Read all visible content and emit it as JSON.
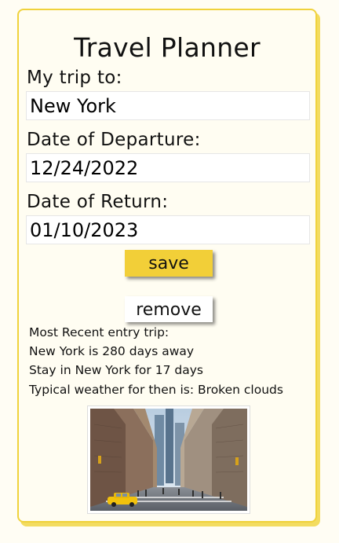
{
  "app": {
    "title": "Travel Planner"
  },
  "form": {
    "destination_label": "My trip to:",
    "destination_value": "New York",
    "departure_label": "Date of Departure:",
    "departure_value": "12/24/2022",
    "return_label": "Date of Return:",
    "return_value": "01/10/2023",
    "save_label": "save",
    "remove_label": "remove"
  },
  "entry": {
    "heading": "Most Recent entry trip:",
    "days_away": "New York is 280 days away",
    "stay_length": "Stay in New York for 17 days",
    "weather": "Typical weather for then is: Broken clouds"
  },
  "colors": {
    "accent": "#f2cf38",
    "card_border": "#f0d23c",
    "background": "#fffdf4"
  },
  "icons": {
    "destination_photo": "city-street-photo"
  }
}
